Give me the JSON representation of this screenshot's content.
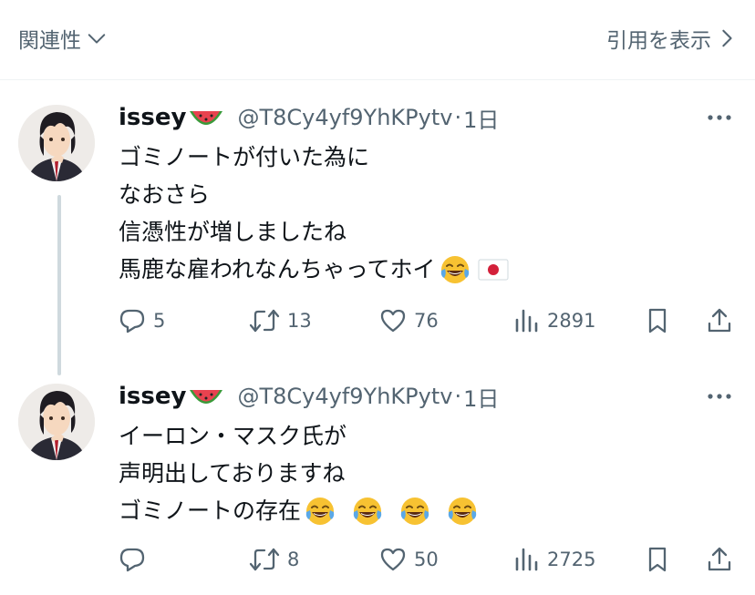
{
  "topbar": {
    "related_label": "関連性",
    "quote_label": "引用を表示"
  },
  "tweets": [
    {
      "name": "issey",
      "name_emoji": "watermelon",
      "handle": "@T8Cy4yf9YhKPytv",
      "dot": "·",
      "time": "1日",
      "lines": [
        "ゴミノートが付いた為に",
        "なおさら",
        "信憑性が増しましたね",
        "馬鹿な雇われなんちゃってホイ"
      ],
      "line_emojis": [
        "tears-of-joy",
        "japan-flag"
      ],
      "replies": "5",
      "reposts": "13",
      "likes": "76",
      "views": "2891"
    },
    {
      "name": "issey",
      "name_emoji": "watermelon",
      "handle": "@T8Cy4yf9YhKPytv",
      "dot": "·",
      "time": "1日",
      "lines": [
        "イーロン・マスク氏が",
        "声明出しておりますね",
        "ゴミノートの存在"
      ],
      "line_emojis": [
        "tears-of-joy",
        "tears-of-joy",
        "tears-of-joy",
        "tears-of-joy"
      ],
      "replies": "",
      "reposts": "8",
      "likes": "50",
      "views": "2725"
    }
  ],
  "icons": {
    "related": "chevron-down-icon",
    "quote": "chevron-right-icon",
    "more": "more-horizontal-icon",
    "reply": "reply-icon",
    "repost": "repost-icon",
    "like": "heart-icon",
    "views": "views-icon",
    "bookmark": "bookmark-icon",
    "share": "share-icon"
  },
  "colors": {
    "text": "#0f1419",
    "secondary": "#536471",
    "divider": "#eff3f4",
    "thread_line": "#cfd9de"
  }
}
